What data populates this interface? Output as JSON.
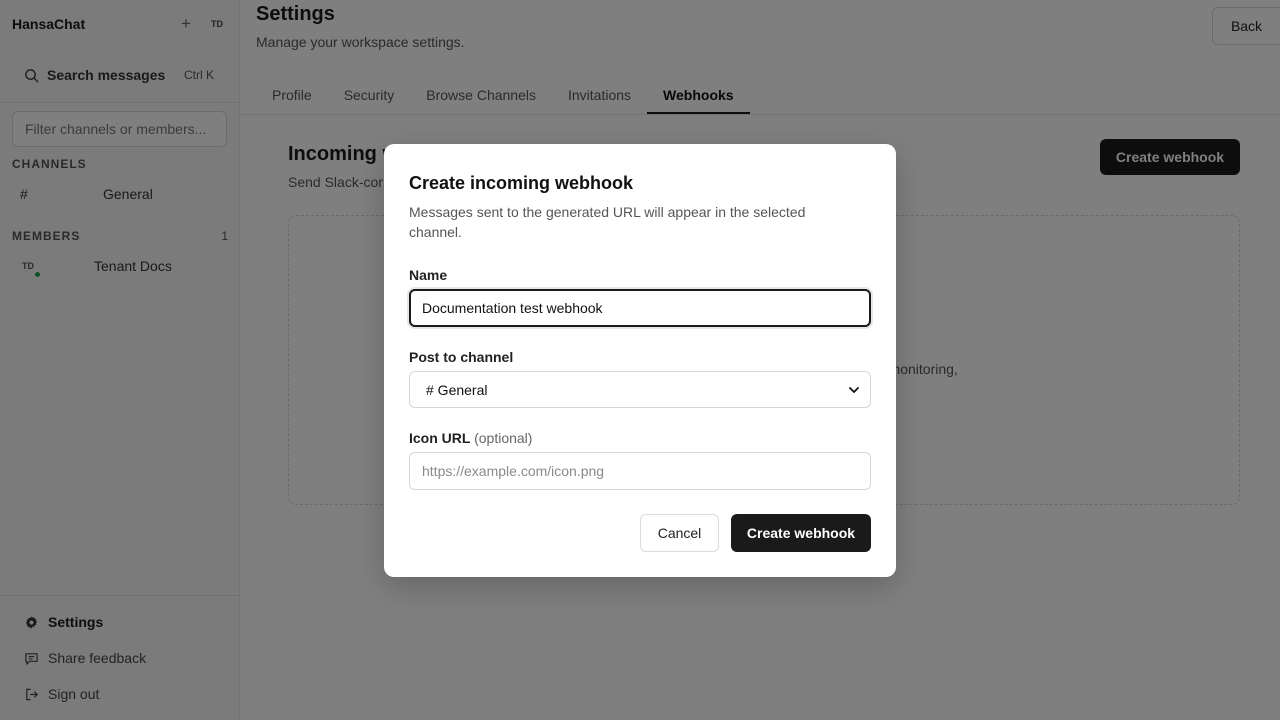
{
  "sidebar": {
    "app_name": "HansaChat",
    "avatar_initials": "TD",
    "search": {
      "label": "Search messages",
      "shortcut": "Ctrl K"
    },
    "filter_placeholder": "Filter channels or members...",
    "channels_heading": "CHANNELS",
    "channels": [
      {
        "prefix": "#",
        "name": "General"
      }
    ],
    "members_heading": "MEMBERS",
    "members_count": "1",
    "members": [
      {
        "initials": "TD",
        "name": "Tenant Docs",
        "status": "online"
      }
    ],
    "bottom": {
      "settings": "Settings",
      "feedback": "Share feedback",
      "signout": "Sign out"
    }
  },
  "header": {
    "title": "Settings",
    "subtitle": "Manage your workspace settings.",
    "back_label": "Back"
  },
  "tabs": [
    {
      "label": "Profile",
      "active": false
    },
    {
      "label": "Security",
      "active": false
    },
    {
      "label": "Browse Channels",
      "active": false
    },
    {
      "label": "Invitations",
      "active": false
    },
    {
      "label": "Webhooks",
      "active": true
    }
  ],
  "webhooks_page": {
    "title_partial": "Incoming w",
    "subtitle_partial": "Send Slack-cor",
    "create_button": "Create webhook",
    "empty_text_partial": "m monitoring,"
  },
  "modal": {
    "title": "Create incoming webhook",
    "description": "Messages sent to the generated URL will appear in the selected channel.",
    "name_label": "Name",
    "name_value": "Documentation test webhook",
    "channel_label": "Post to channel",
    "channel_value": "# General",
    "icon_label": "Icon URL",
    "icon_optional": "(optional)",
    "icon_placeholder": "https://example.com/icon.png",
    "cancel_label": "Cancel",
    "submit_label": "Create webhook"
  },
  "colors": {
    "primary_button": "#1a1a1a",
    "online": "#1fa34a",
    "overlay": "rgba(0,0,0,0.5)"
  }
}
